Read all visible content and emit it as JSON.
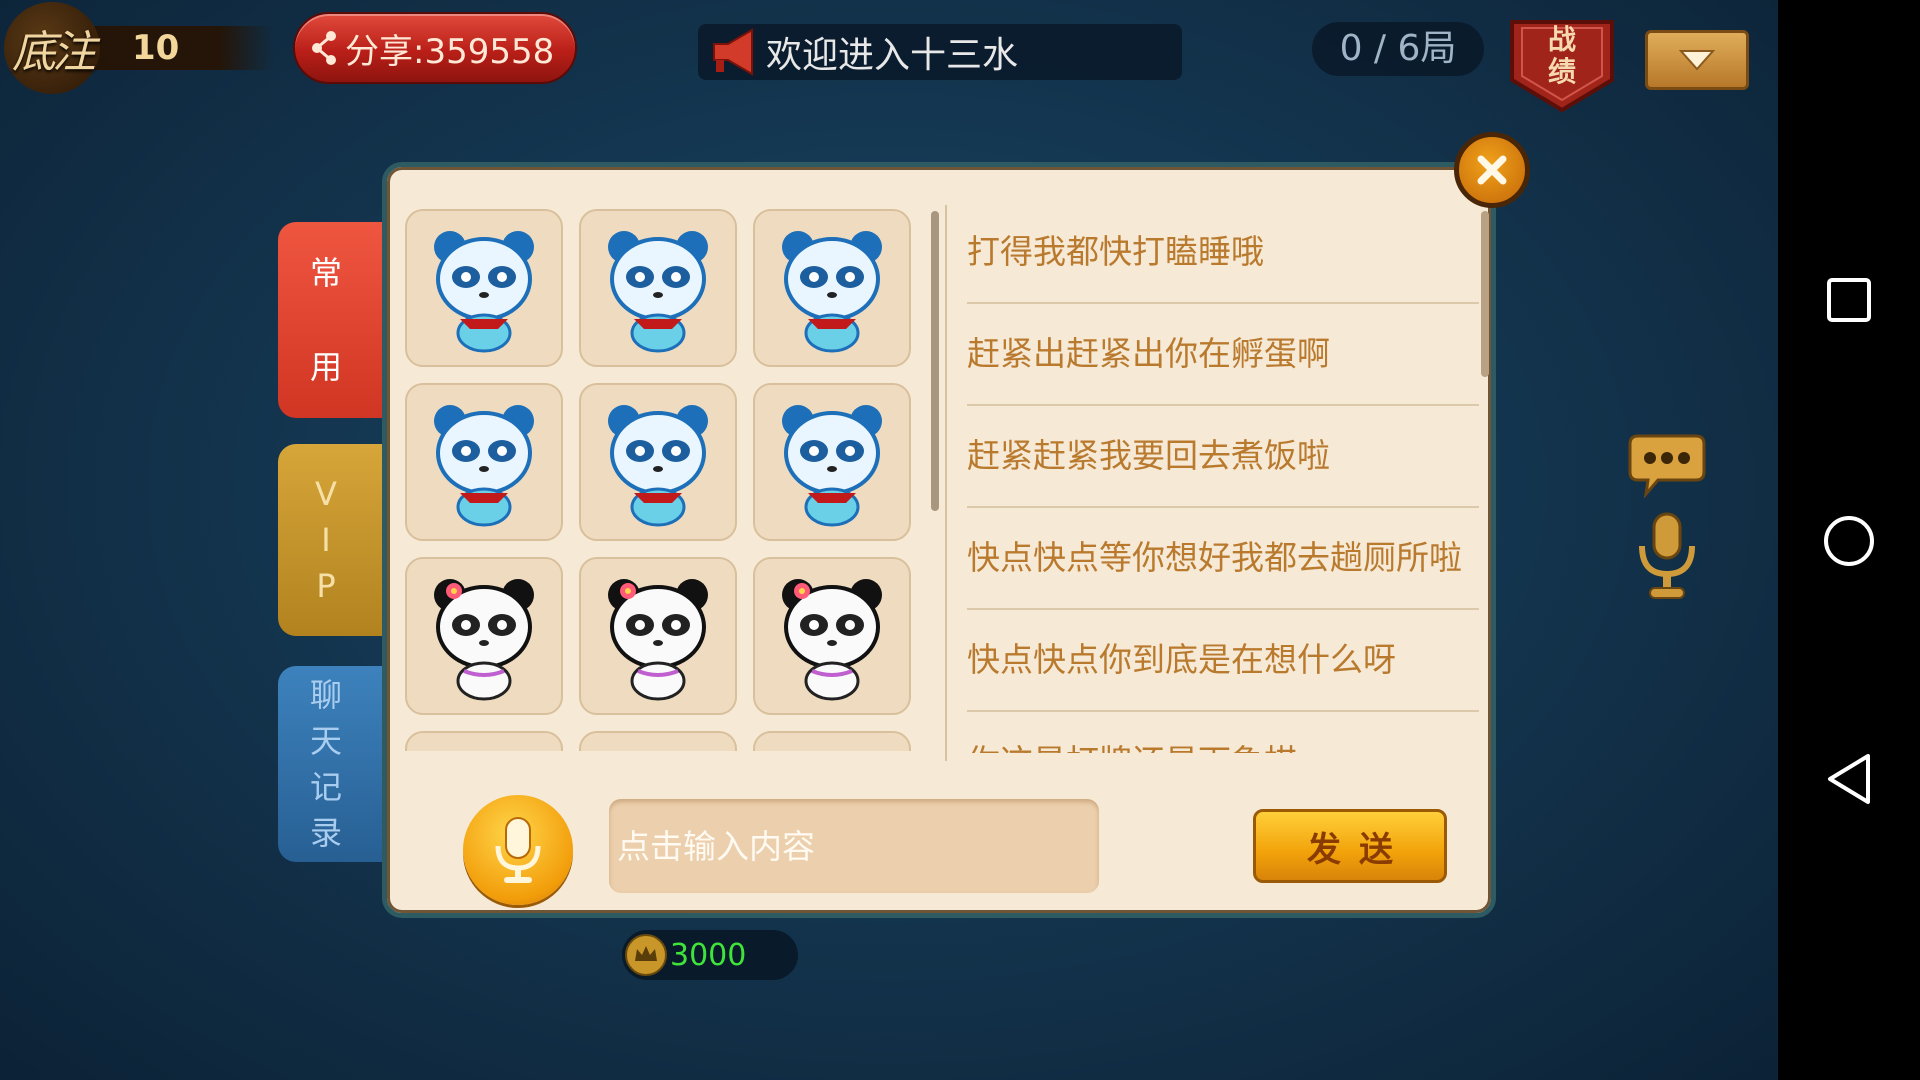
{
  "topbar": {
    "bet_logo": "底注",
    "bet_value": "10",
    "share_label": "分享:359558",
    "marquee_text": "欢迎进入十三水",
    "rounds": "0 / 6局",
    "record_label_1": "战",
    "record_label_2": "绩"
  },
  "tabs": {
    "common": [
      "常",
      "用"
    ],
    "vip": [
      "V",
      "I",
      "P"
    ],
    "history": [
      "聊",
      "天",
      "记",
      "录"
    ]
  },
  "phrases": [
    "打得我都快打瞌睡哦",
    "赶紧出赶紧出你在孵蛋啊",
    "赶紧赶紧我要回去煮饭啦",
    "快点快点等你想好我都去趟厕所啦",
    "快点快点你到底是在想什么呀",
    "你这是打牌还是下象棋"
  ],
  "emojis": [
    "blue-panda-nervous",
    "blue-panda-annoyed",
    "blue-panda-sleepy",
    "blue-panda-angry",
    "blue-panda-wink",
    "blue-panda-shy",
    "girl-panda-cheer",
    "girl-panda-sly",
    "girl-panda-blush",
    "girl-panda-partial",
    "blue-panda-partial",
    "blue-panda-partial"
  ],
  "input": {
    "placeholder": "点击输入内容"
  },
  "send_label": "发送",
  "coin": {
    "value": "3000"
  },
  "colors": {
    "accent_orange": "#f2a20a",
    "phrase_text": "#b97a2e",
    "coin_green": "#3fe43a",
    "tab_common": "#e04530",
    "tab_vip": "#c6952c",
    "tab_history": "#3273ad"
  }
}
